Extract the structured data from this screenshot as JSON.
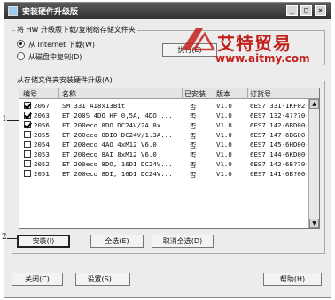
{
  "window": {
    "title": "安装硬件升级版",
    "min_glyph": "_",
    "max_glyph": "□",
    "close_glyph": "×"
  },
  "source_group": {
    "label": "将 HW 升级版下载/复制给存储文件夹",
    "option_internet": "从 Internet 下载(W)",
    "option_disk": "从磁盘中复制(D)",
    "execute_button": "执行(E)",
    "selected": "internet"
  },
  "watermark": {
    "text": "艾特贸易",
    "url": "www.aitmy.com"
  },
  "install_group": {
    "label": "从存储文件夹安装硬件升级(A)",
    "columns": [
      "编号",
      "名称",
      "已安装",
      "版本",
      "订货号"
    ],
    "rows": [
      {
        "checked": true,
        "id": "2067",
        "name": "SM 331 AI8x13Bit",
        "installed": "否",
        "version": "V1.0",
        "order": "6ES7 331-1KF02-"
      },
      {
        "checked": true,
        "id": "2063",
        "name": "ET 200S 4DO HF 0,5A, 4DO ...",
        "installed": "否",
        "version": "V1.0",
        "order": "6ES7 132-4???0-"
      },
      {
        "checked": true,
        "id": "2056",
        "name": "ET 200eco 8DO DC24V/2A 8x...",
        "installed": "否",
        "version": "V1.0",
        "order": "6ES7 142-6BD00-"
      },
      {
        "checked": false,
        "id": "2055",
        "name": "ET 200eco 8DIO DC24V/1.3A...",
        "installed": "否",
        "version": "V1.0",
        "order": "6ES7 147-6BG00-"
      },
      {
        "checked": false,
        "id": "2054",
        "name": "ET 200eco 4AO 4xM12 V6.0",
        "installed": "否",
        "version": "V1.0",
        "order": "6ES7 145-6HD00-"
      },
      {
        "checked": false,
        "id": "2053",
        "name": "ET 200eco 8AI 8xM12 V6.0",
        "installed": "否",
        "version": "V1.0",
        "order": "6ES7 144-6KD00-"
      },
      {
        "checked": false,
        "id": "2052",
        "name": "ET 200eco 8DO, 16DI DC24V...",
        "installed": "否",
        "version": "V1.0",
        "order": "6ES7 142-6B?70-"
      },
      {
        "checked": false,
        "id": "2051",
        "name": "ET 200eco 8DI, 16DI DC24V...",
        "installed": "否",
        "version": "V1.0",
        "order": "6ES7 141-6B?00-"
      }
    ],
    "install_button": "安装(I)",
    "select_all_button": "全选(E)",
    "deselect_all_button": "取消全选(D)"
  },
  "footer": {
    "close_button": "关闭(C)",
    "settings_button": "设置(S)...",
    "help_button": "帮助(H)"
  },
  "callouts": {
    "one": "1",
    "two": "2"
  }
}
